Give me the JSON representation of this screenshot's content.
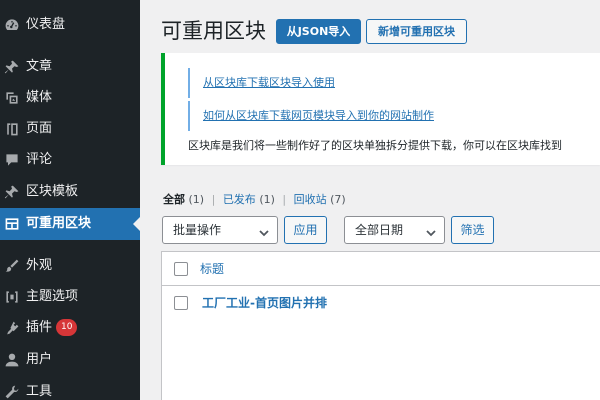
{
  "sidebar": {
    "items": [
      {
        "label": "仪表盘",
        "icon": "dashboard-icon"
      },
      {
        "label": "文章",
        "icon": "pin-icon"
      },
      {
        "label": "媒体",
        "icon": "media-icon"
      },
      {
        "label": "页面",
        "icon": "page-icon"
      },
      {
        "label": "评论",
        "icon": "comment-icon"
      },
      {
        "label": "区块模板",
        "icon": "pin-icon"
      },
      {
        "label": "可重用区块",
        "icon": "table-icon",
        "active": true
      },
      {
        "label": "外观",
        "icon": "brush-icon"
      },
      {
        "label": "主题选项",
        "icon": "theme-options-icon"
      },
      {
        "label": "插件",
        "icon": "plugin-icon",
        "badge": "10"
      },
      {
        "label": "用户",
        "icon": "user-icon"
      },
      {
        "label": "工具",
        "icon": "wrench-icon"
      }
    ],
    "active_color": "#2271b1",
    "badge_color": "#d63638"
  },
  "header": {
    "title": "可重用区块",
    "import_button": "从JSON导入",
    "new_button": "新增可重用区块"
  },
  "notice": {
    "link1": "从区块库下载区块导入使用",
    "link2": "如何从区块库下载网页模块导入到你的网站制作",
    "description": "区块库是我们将一些制作好了的区块单独拆分提供下载，你可以在区块库找到",
    "border_color": "#00a32a"
  },
  "views": {
    "all_label": "全部",
    "all_count": "(1)",
    "published_label": "已发布",
    "published_count": "(1)",
    "trash_label": "回收站",
    "trash_count": "(7)",
    "separator": "|"
  },
  "filters": {
    "bulk_action": "批量操作",
    "apply": "应用",
    "date": "全部日期",
    "filter": "筛选"
  },
  "table": {
    "header_title": "标题",
    "rows": [
      {
        "title": "工厂工业-首页图片并排"
      }
    ]
  }
}
